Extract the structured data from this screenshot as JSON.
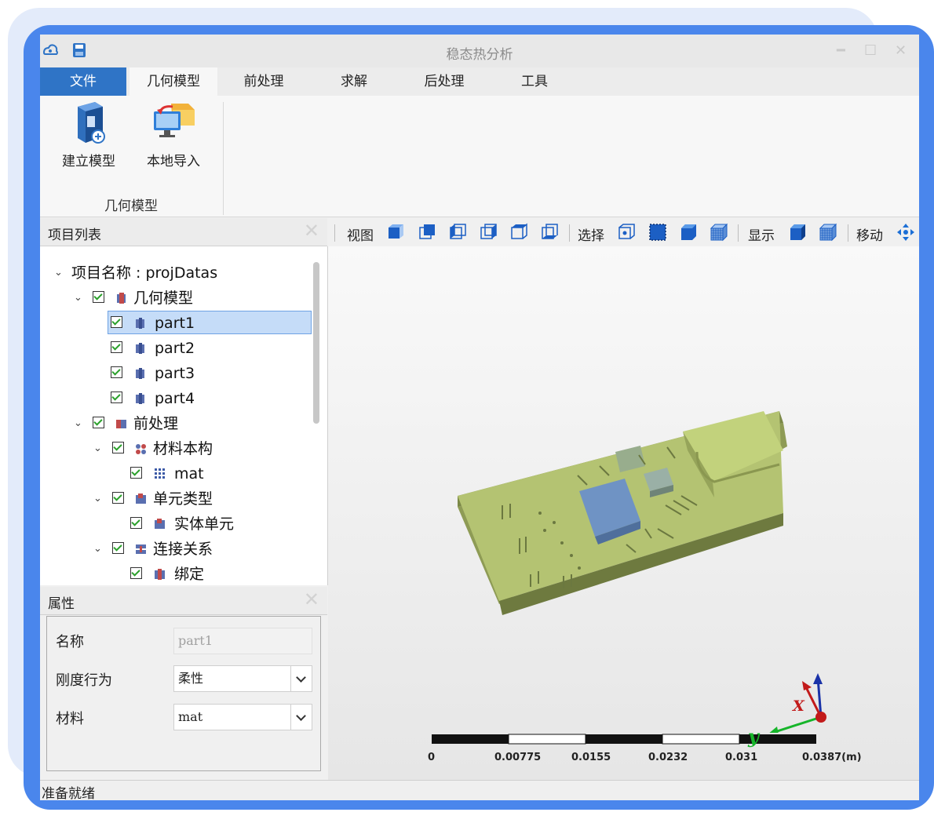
{
  "window": {
    "title": "稳态热分析"
  },
  "menu": {
    "tabs": [
      "文件",
      "几何模型",
      "前处理",
      "求解",
      "后处理",
      "工具"
    ]
  },
  "ribbon": {
    "buttons": [
      "建立模型",
      "本地导入"
    ],
    "group_label": "几何模型"
  },
  "project_panel": {
    "title": "项目列表",
    "root_label": "项目名称 : projDatas",
    "items": [
      "几何模型",
      "part1",
      "part2",
      "part3",
      "part4",
      "前处理",
      "材料本构",
      "mat",
      "单元类型",
      "实体单元",
      "连接关系",
      "绑定"
    ],
    "selected": "part1"
  },
  "properties": {
    "title": "属性",
    "name_label": "名称",
    "name_value": "part1",
    "stiffness_label": "刚度行为",
    "stiffness_value": "柔性",
    "material_label": "材料",
    "material_value": "mat"
  },
  "toolbar": {
    "view_label": "视图",
    "select_label": "选择",
    "display_label": "显示",
    "move_label": "移动"
  },
  "axes": {
    "x_label": "X",
    "y_label": "y"
  },
  "scale": {
    "ticks": [
      "0",
      "0.00775",
      "0.0155",
      "0.0232",
      "0.031",
      "0.0387(m)"
    ]
  },
  "status": {
    "text": "准备就绪"
  },
  "colors": {
    "accent": "#2f74c6",
    "frame": "#4a86ec",
    "model": "#b4c372",
    "chip": "#6f93c4"
  }
}
